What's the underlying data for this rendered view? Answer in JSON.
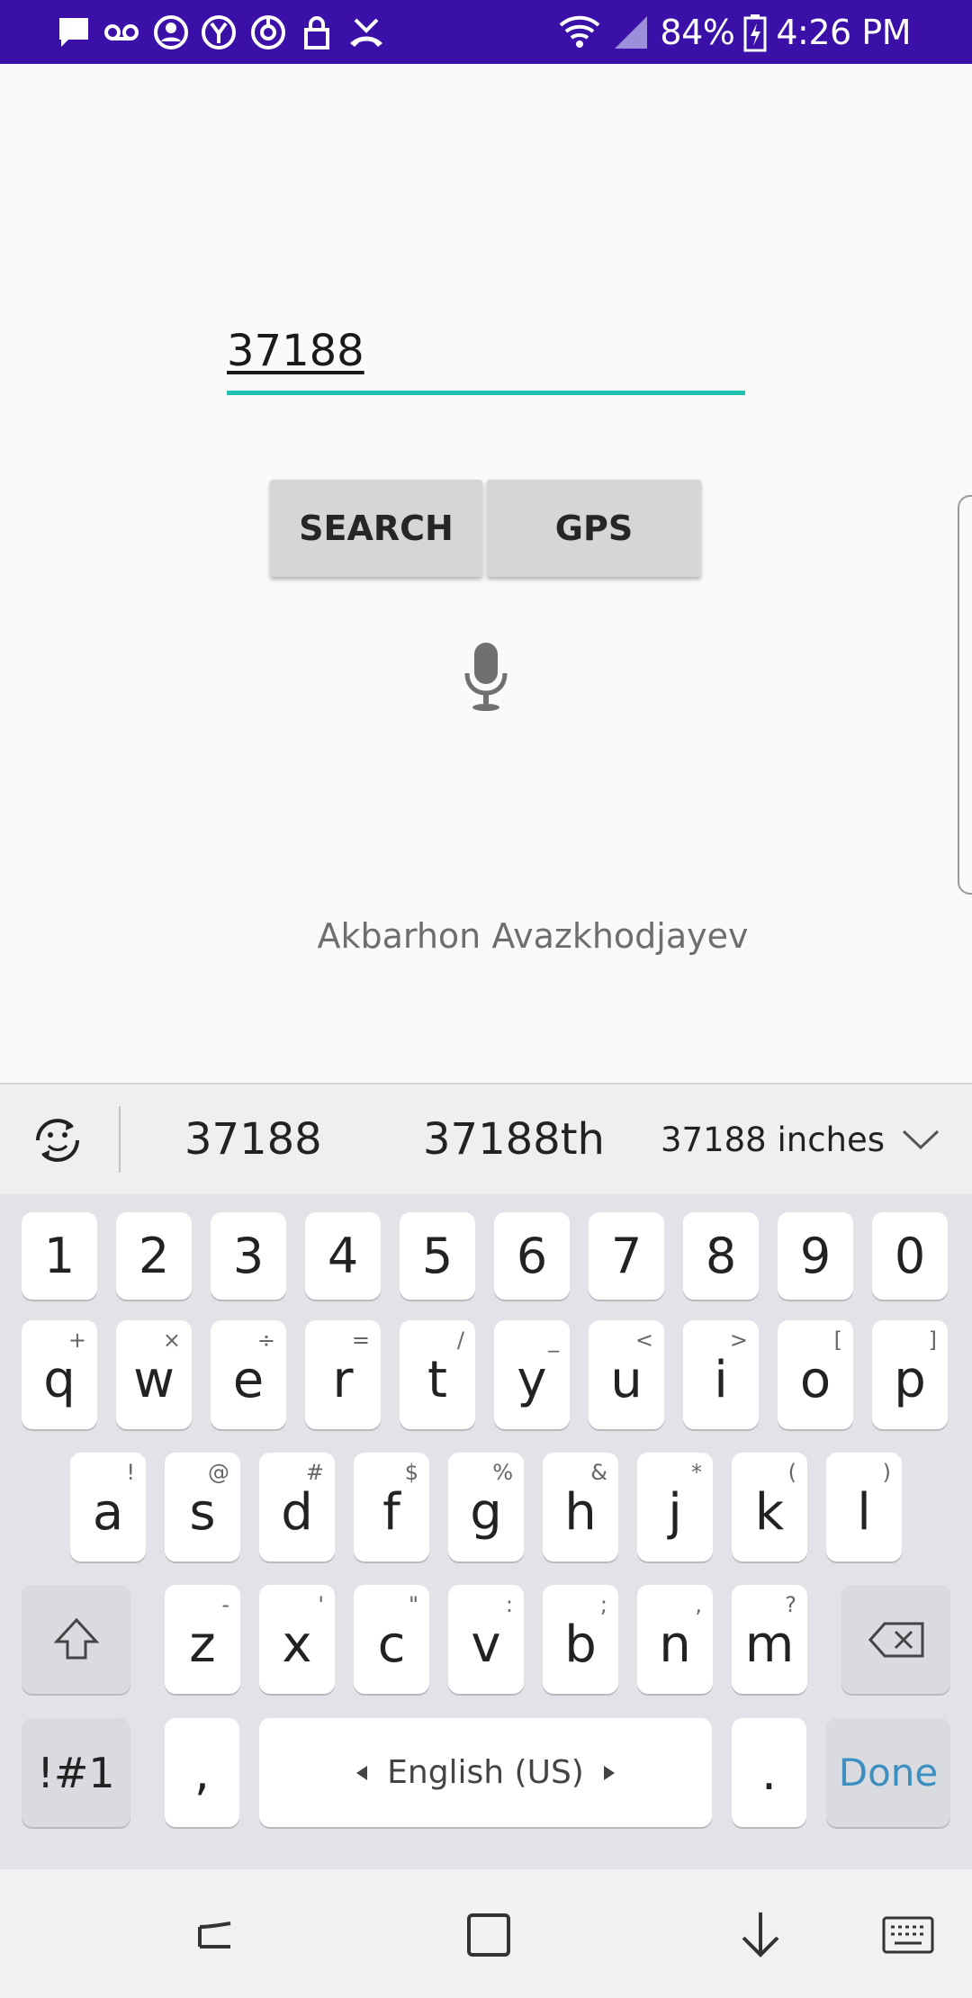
{
  "status_bar": {
    "battery": "84%",
    "time": "4:26 PM",
    "icons": [
      "message-icon",
      "voicemail-icon",
      "account-icon",
      "yahoo-icon",
      "sync-icon",
      "lock-icon",
      "missed-call-icon",
      "wifi-icon",
      "signal-icon",
      "battery-charging-icon"
    ]
  },
  "app": {
    "zip_value": "37188",
    "search_label": "SEARCH",
    "gps_label": "GPS",
    "author": "Akbarhon Avazkhodjayev",
    "accent_color": "#1fc3b2"
  },
  "keyboard": {
    "suggestions": [
      "37188",
      "37188th",
      "37188 inches"
    ],
    "number_row": [
      "1",
      "2",
      "3",
      "4",
      "5",
      "6",
      "7",
      "8",
      "9",
      "0"
    ],
    "row1": [
      {
        "k": "q",
        "s": "+"
      },
      {
        "k": "w",
        "s": "×"
      },
      {
        "k": "e",
        "s": "÷"
      },
      {
        "k": "r",
        "s": "="
      },
      {
        "k": "t",
        "s": "/"
      },
      {
        "k": "y",
        "s": "_"
      },
      {
        "k": "u",
        "s": "<"
      },
      {
        "k": "i",
        "s": ">"
      },
      {
        "k": "o",
        "s": "["
      },
      {
        "k": "p",
        "s": "]"
      }
    ],
    "row2": [
      {
        "k": "a",
        "s": "!"
      },
      {
        "k": "s",
        "s": "@"
      },
      {
        "k": "d",
        "s": "#"
      },
      {
        "k": "f",
        "s": "$"
      },
      {
        "k": "g",
        "s": "%"
      },
      {
        "k": "h",
        "s": "&"
      },
      {
        "k": "j",
        "s": "*"
      },
      {
        "k": "k",
        "s": "("
      },
      {
        "k": "l",
        "s": ")"
      }
    ],
    "row3": [
      {
        "k": "z",
        "s": "-"
      },
      {
        "k": "x",
        "s": "'"
      },
      {
        "k": "c",
        "s": "\""
      },
      {
        "k": "v",
        "s": ":"
      },
      {
        "k": "b",
        "s": ";"
      },
      {
        "k": "n",
        "s": ","
      },
      {
        "k": "m",
        "s": "?"
      }
    ],
    "symbols_label": "!#1",
    "comma_label": ",",
    "space_label": "English (US)",
    "period_label": ".",
    "done_label": "Done",
    "done_color": "#3d8fc0"
  }
}
